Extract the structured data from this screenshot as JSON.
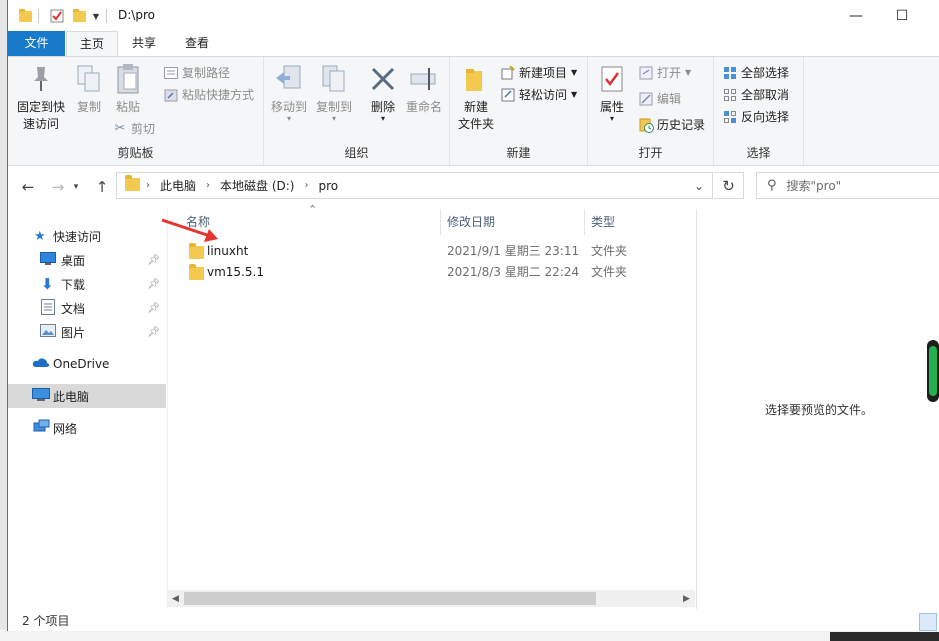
{
  "window": {
    "title": "D:\\pro",
    "minimize": "—",
    "maximize": "☐"
  },
  "ribbon_tabs": [
    {
      "label": "文件"
    },
    {
      "label": "主页"
    },
    {
      "label": "共享"
    },
    {
      "label": "查看"
    }
  ],
  "ribbon": {
    "clipboard": {
      "pin_label_1": "固定到快",
      "pin_label_2": "速访问",
      "copy": "复制",
      "paste": "粘贴",
      "copy_path": "复制路径",
      "paste_shortcut": "粘贴快捷方式",
      "cut": "剪切",
      "group": "剪贴板"
    },
    "organize": {
      "move_to": "移动到",
      "copy_to": "复制到",
      "delete": "删除",
      "rename": "重命名",
      "group": "组织"
    },
    "new": {
      "new_folder_1": "新建",
      "new_folder_2": "文件夹",
      "new_item": "新建项目",
      "easy_access": "轻松访问",
      "group": "新建"
    },
    "open": {
      "properties": "属性",
      "open": "打开",
      "edit": "编辑",
      "history": "历史记录",
      "group": "打开"
    },
    "select": {
      "select_all": "全部选择",
      "select_none": "全部取消",
      "invert": "反向选择",
      "group": "选择"
    }
  },
  "address": {
    "crumbs": [
      "此电脑",
      "本地磁盘 (D:)",
      "pro"
    ],
    "search_placeholder": "搜索\"pro\""
  },
  "nav": {
    "quick_access": "快速访问",
    "items": [
      {
        "label": "桌面"
      },
      {
        "label": "下载"
      },
      {
        "label": "文档"
      },
      {
        "label": "图片"
      }
    ],
    "onedrive": "OneDrive",
    "this_pc": "此电脑",
    "network": "网络"
  },
  "columns": {
    "name": "名称",
    "date": "修改日期",
    "type": "类型"
  },
  "files": [
    {
      "name": "linuxht",
      "date": "2021/9/1 星期三 23:11",
      "type": "文件夹"
    },
    {
      "name": "vm15.5.1",
      "date": "2021/8/3 星期二 22:24",
      "type": "文件夹"
    }
  ],
  "preview": {
    "empty_text": "选择要预览的文件。"
  },
  "status": {
    "count": "2 个项目"
  },
  "colors": {
    "accent": "#1979ca",
    "folder": "#f3c94f",
    "annotation": "#e8322d"
  }
}
